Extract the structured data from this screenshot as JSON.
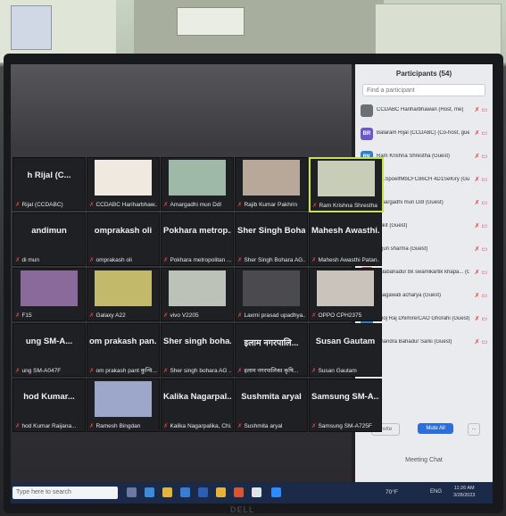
{
  "participants_panel": {
    "title": "Participants (54)",
    "search_placeholder": "Find a participant",
    "rows": [
      {
        "avatar": "",
        "name": "CCDABC Hariharbhawan (Host, me)",
        "color": "#6b6f76"
      },
      {
        "avatar": "BR",
        "name": "Balaram Rijal (CCDABC) (Co-host, guest)",
        "color": "#6e57c9"
      },
      {
        "avatar": "RK",
        "name": "Ram Krishna Shrestha (Guest)",
        "color": "#2f80c9"
      },
      {
        "avatar": "S",
        "name": "S)LSpoelfMbCFC86CH 4D1SeKiry (Guest)",
        "color": "#e07a2c"
      },
      {
        "avatar": "AM",
        "name": "Amargadhi mun Ddl (Guest)",
        "color": "#2f80c9"
      },
      {
        "avatar": "A",
        "name": "ankit (Guest)",
        "color": "#d9443f"
      },
      {
        "avatar": "AS",
        "name": "Arjun sharma (Guest)",
        "color": "#3c6e9e"
      },
      {
        "avatar": "BB",
        "name": "balabahadur bk swamikartik khapa... (Guest)",
        "color": "#d9443f"
      },
      {
        "avatar": "BA",
        "name": "bhagawati acharya (Guest)",
        "color": "#2f9e8f"
      },
      {
        "avatar": "BR",
        "name": "Bhoj Raj Dhimire/CAO Ghorahi (Guest)",
        "color": "#2f80c9"
      },
      {
        "avatar": "CB",
        "name": "Chandra Bahadur Sarki (Guest)",
        "color": "#2f80c9"
      }
    ],
    "invite_label": "Invite",
    "mute_all_label": "Mute All",
    "more_label": "...",
    "meeting_chat_label": "Meeting Chat"
  },
  "tiles": [
    {
      "title": "h Rijal (C...",
      "label": "Rijal (CCDABC)"
    },
    {
      "title": "",
      "label": "CCDABC Hariharbhaw..."
    },
    {
      "title": "",
      "label": "Amargadhi mun Ddl"
    },
    {
      "title": "",
      "label": "Rajib Kumar Pakhrin"
    },
    {
      "title": "",
      "label": "Ram Krishna Shrestha"
    },
    {
      "title": "andimun",
      "label": "di mun"
    },
    {
      "title": "omprakash oli",
      "label": "omprakash oli"
    },
    {
      "title": "Pokhara metrop...",
      "label": "Pokhara metropolitan ..."
    },
    {
      "title": "Sher Singh Boha...",
      "label": "Sher Singh Bohara AG..."
    },
    {
      "title": "Mahesh Awasthi...",
      "label": "Mahesh Awasthi Patan..."
    },
    {
      "title": "",
      "label": "F15"
    },
    {
      "title": "",
      "label": "Galaxy A22"
    },
    {
      "title": "",
      "label": "vivo V2205"
    },
    {
      "title": "",
      "label": "Laxmi prasad upadhya..."
    },
    {
      "title": "",
      "label": "OPPO CPH2375"
    },
    {
      "title": "ung SM-A...",
      "label": "ung SM-A047F"
    },
    {
      "title": "om prakash pan...",
      "label": "om prakash pant कुन्चि..."
    },
    {
      "title": "Sher singh boha...",
      "label": "Sher singh bohara AG ..."
    },
    {
      "title": "इलाम नगरपालि...",
      "label": "इलाम नगरपालिका कृषि..."
    },
    {
      "title": "Susan Gautam",
      "label": "Susan Gautam"
    },
    {
      "title": "hod Kumar...",
      "label": "hod Kumar Raijana..."
    },
    {
      "title": "",
      "label": "Ramesh Bingdan"
    },
    {
      "title": "Kalika Nagarpal...",
      "label": "Kalika Nagarpalika, Chi..."
    },
    {
      "title": "Sushmita aryal",
      "label": "Sushmita aryal"
    },
    {
      "title": "Samsung SM-A...",
      "label": "Samsung SM-A725F"
    }
  ],
  "taskbar": {
    "search_placeholder": "Type here to search",
    "temperature": "70°F",
    "language": "ENG",
    "time": "11:26 AM",
    "date": "3/28/2023"
  },
  "monitor_brand": "DELL"
}
